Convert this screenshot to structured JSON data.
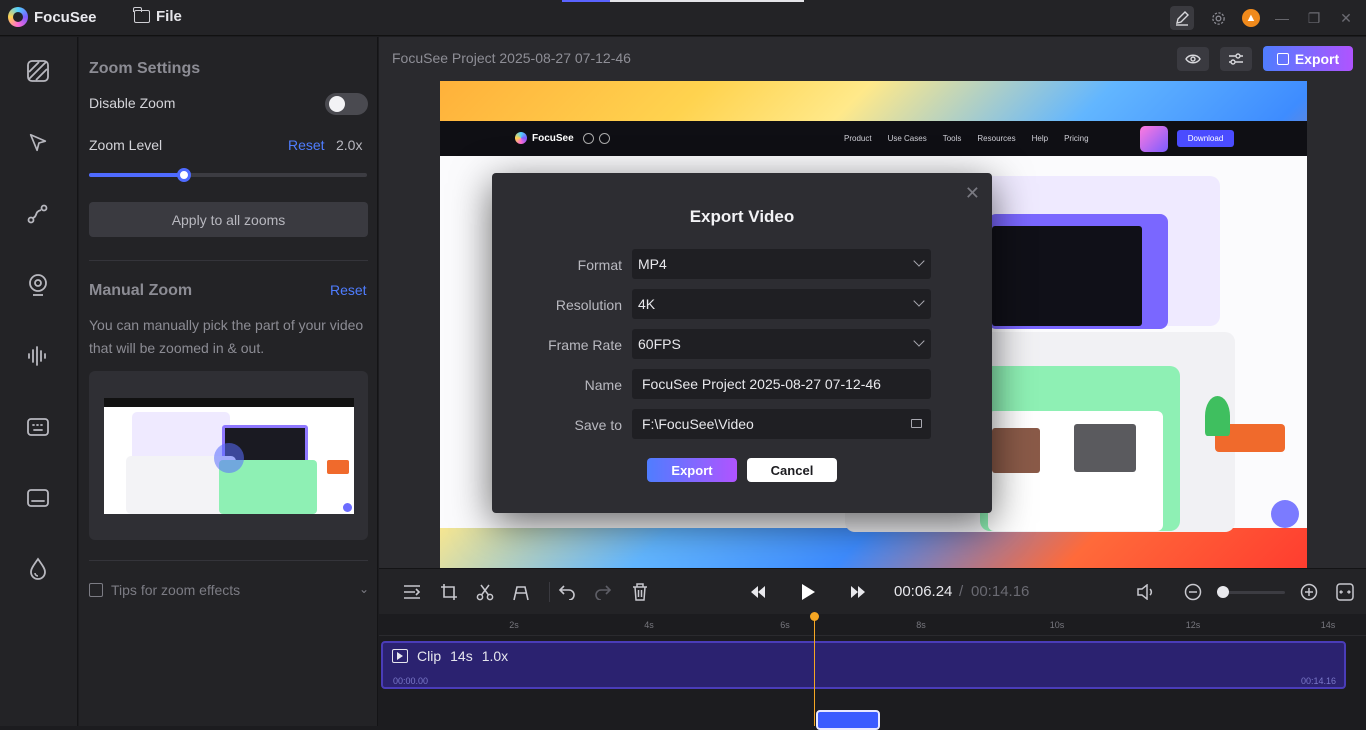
{
  "app": {
    "name": "FocuSee",
    "file_menu": "File"
  },
  "panel": {
    "zoom_settings_title": "Zoom Settings",
    "disable_zoom_label": "Disable Zoom",
    "disable_zoom_on": false,
    "zoom_level_label": "Zoom Level",
    "zoom_level_reset": "Reset",
    "zoom_level_value": "2.0x",
    "zoom_level_fraction": 0.34,
    "apply_all_label": "Apply to all zooms",
    "manual_zoom_title": "Manual Zoom",
    "manual_zoom_reset": "Reset",
    "manual_zoom_desc": "You can manually pick the part of your video that will be zoomed in & out.",
    "tips_label": "Tips for zoom effects"
  },
  "header": {
    "project_title": "FocuSee Project 2025-08-27 07-12-46",
    "export_label": "Export"
  },
  "preview": {
    "site_name": "FocuSee",
    "nav_links": [
      "Product",
      "Use Cases",
      "Tools",
      "Resources",
      "Help",
      "Pricing"
    ],
    "download_label": "Download"
  },
  "dialog": {
    "title": "Export Video",
    "fields": [
      {
        "label": "Format",
        "value": "MP4"
      },
      {
        "label": "Resolution",
        "value": "4K"
      },
      {
        "label": "Frame Rate",
        "value": "60FPS"
      },
      {
        "label": "Name",
        "value": "FocuSee Project 2025-08-27 07-12-46"
      },
      {
        "label": "Save to",
        "value": "F:\\FocuSee\\Video"
      }
    ],
    "export_label": "Export",
    "cancel_label": "Cancel"
  },
  "playback": {
    "current_time": "00:06.24",
    "separator": "/",
    "total_time": "00:14.16"
  },
  "timeline": {
    "ticks": [
      "2s",
      "4s",
      "6s",
      "8s",
      "10s",
      "12s",
      "14s"
    ],
    "clip_label": "Clip",
    "clip_duration": "14s",
    "clip_speed": "1.0x",
    "clip_start": "00:00.00",
    "clip_end": "00:14.16"
  },
  "colors": {
    "accent_blue": "#4f7dff",
    "accent_purple": "#b054ff",
    "playhead": "#f5a623",
    "clip_bg": "#2b2270"
  }
}
